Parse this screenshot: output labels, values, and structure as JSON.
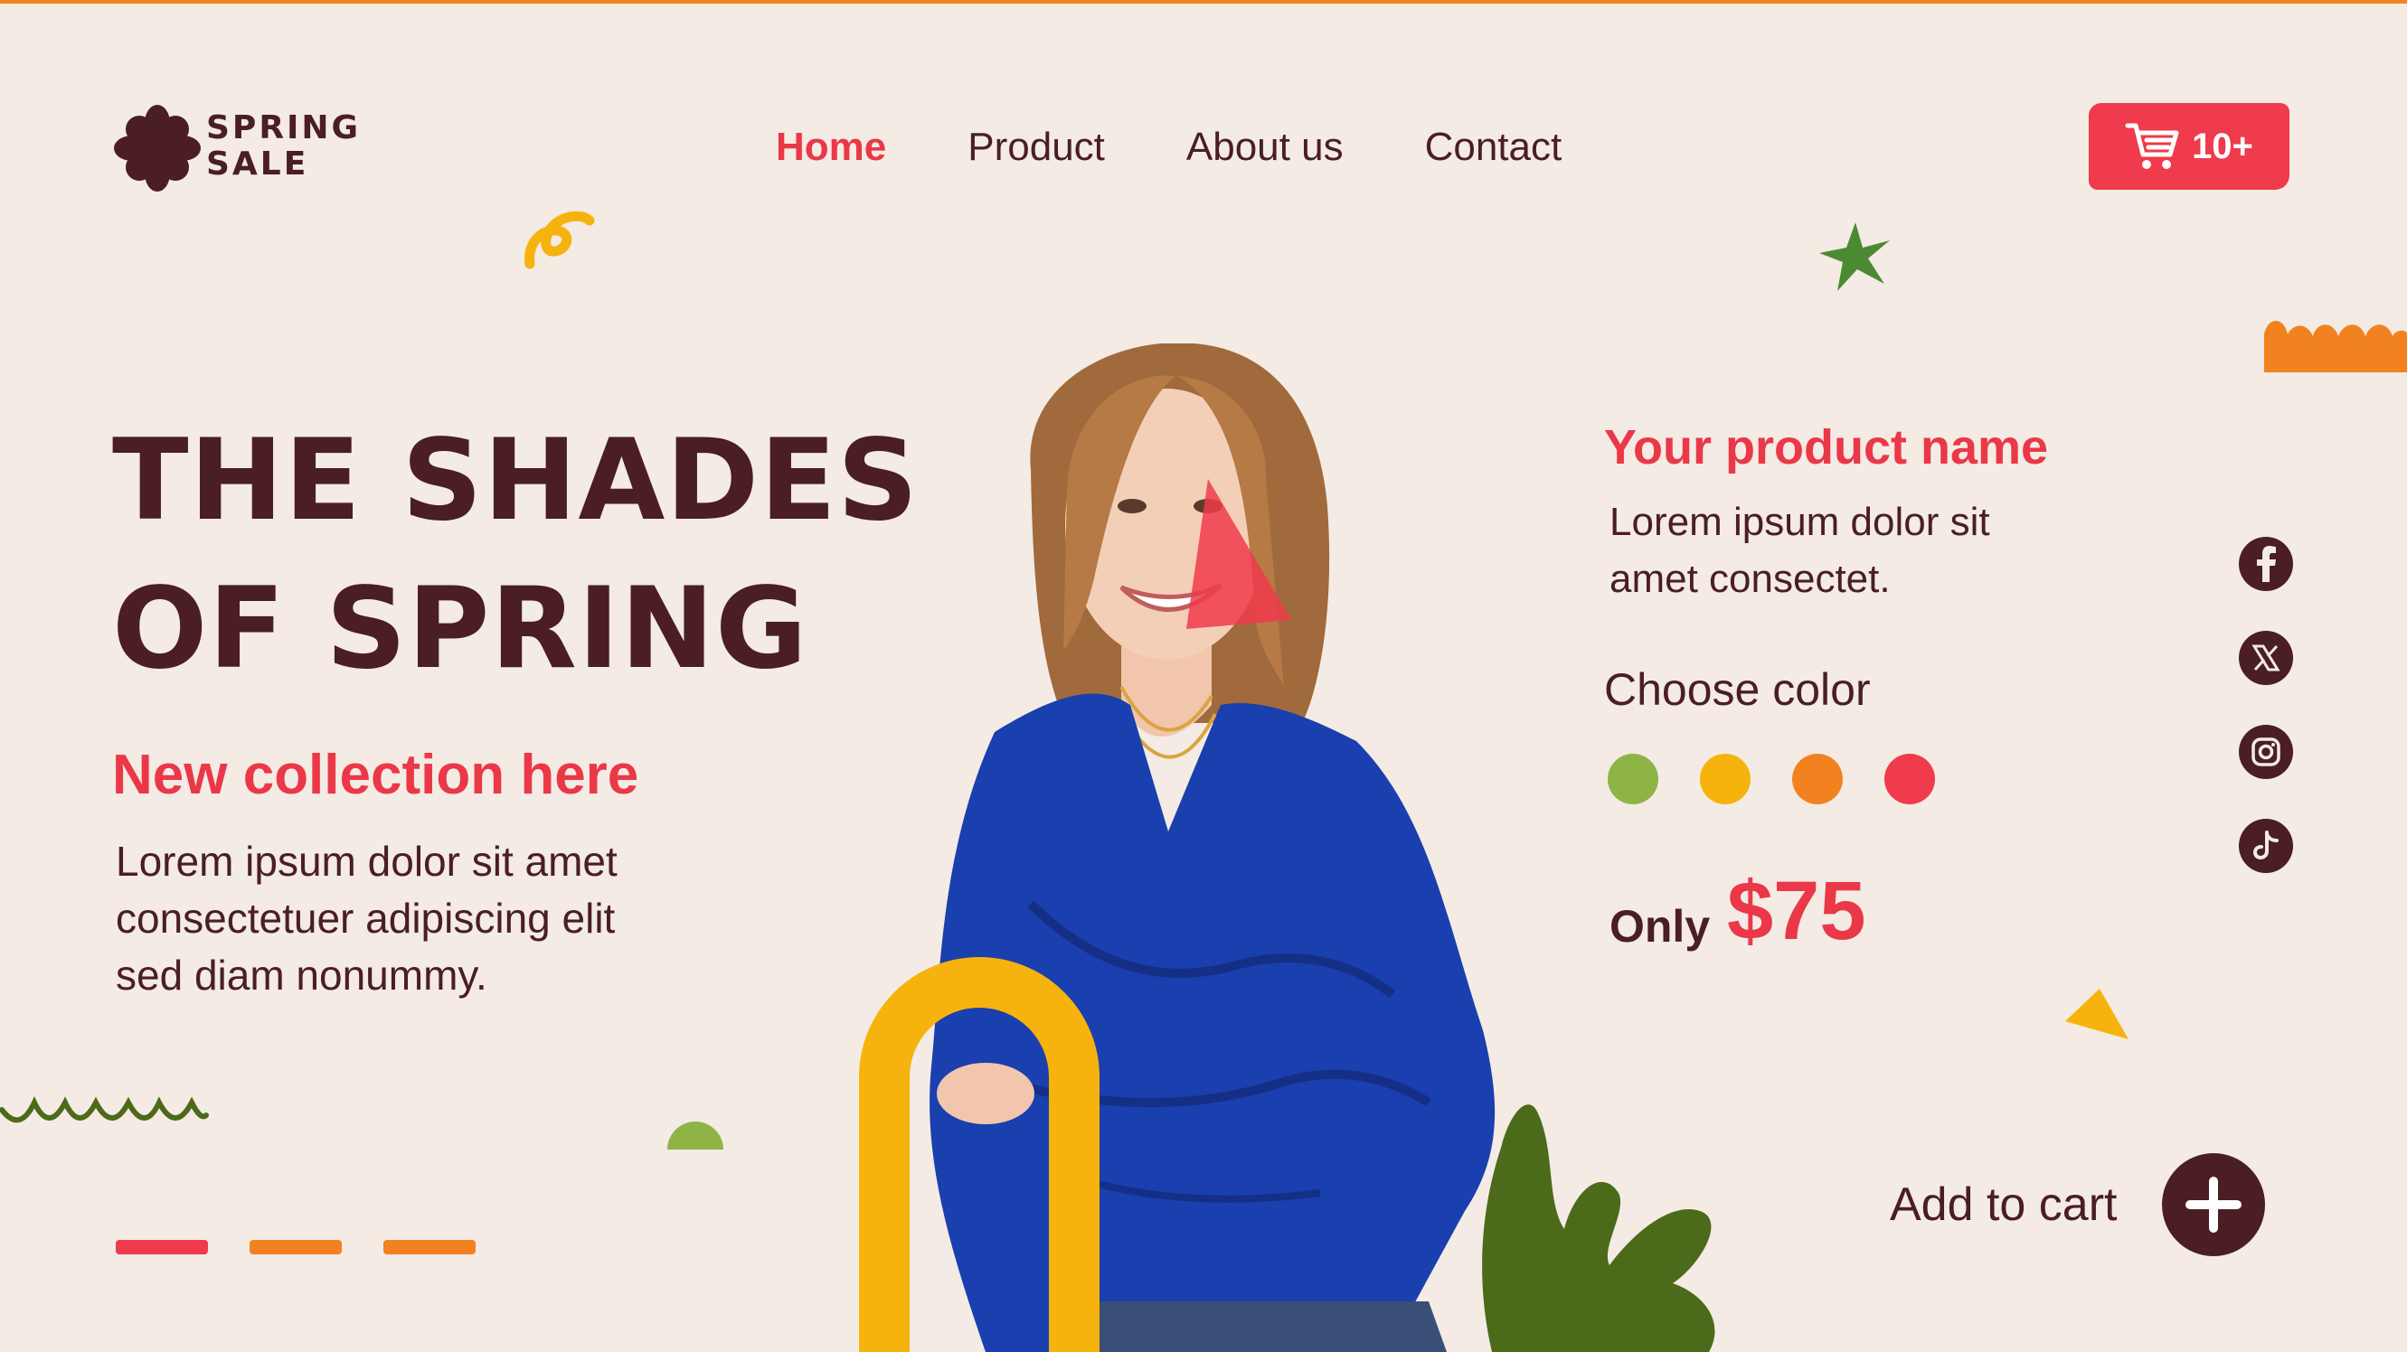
{
  "brand": {
    "logo_text_line1": "SPRING",
    "logo_text_line2": "SALE"
  },
  "nav": {
    "items": [
      {
        "label": "Home",
        "active": true
      },
      {
        "label": "Product",
        "active": false
      },
      {
        "label": "About us",
        "active": false
      },
      {
        "label": "Contact",
        "active": false
      }
    ]
  },
  "cart": {
    "count": "10+",
    "icon": "shopping-cart-icon"
  },
  "hero": {
    "title_line1": "THE SHADES",
    "title_line2": "OF SPRING",
    "subtitle": "New collection here",
    "desc_line1": "Lorem ipsum dolor sit amet",
    "desc_line2": "consectetuer adipiscing elit",
    "desc_line3": "sed diam nonummy."
  },
  "product": {
    "name": "Your product name",
    "desc_line1": "Lorem ipsum dolor sit",
    "desc_line2": "amet consectet.",
    "choose_color_label": "Choose color",
    "colors": [
      "#8fb446",
      "#f7b30d",
      "#f2821f",
      "#ef3b4b"
    ],
    "price_label": "Only",
    "price_value": "$75",
    "add_to_cart_label": "Add to cart"
  },
  "social": [
    "facebook-icon",
    "x-icon",
    "instagram-icon",
    "tiktok-icon"
  ],
  "palette": {
    "brown": "#4a1e22",
    "red": "#ea3848",
    "orange": "#f2821f",
    "yellow": "#f7b30d",
    "green": "#8fb446",
    "dark_green": "#4b6a1a",
    "blue": "#1a3fae",
    "background": "#f3ebe4"
  }
}
